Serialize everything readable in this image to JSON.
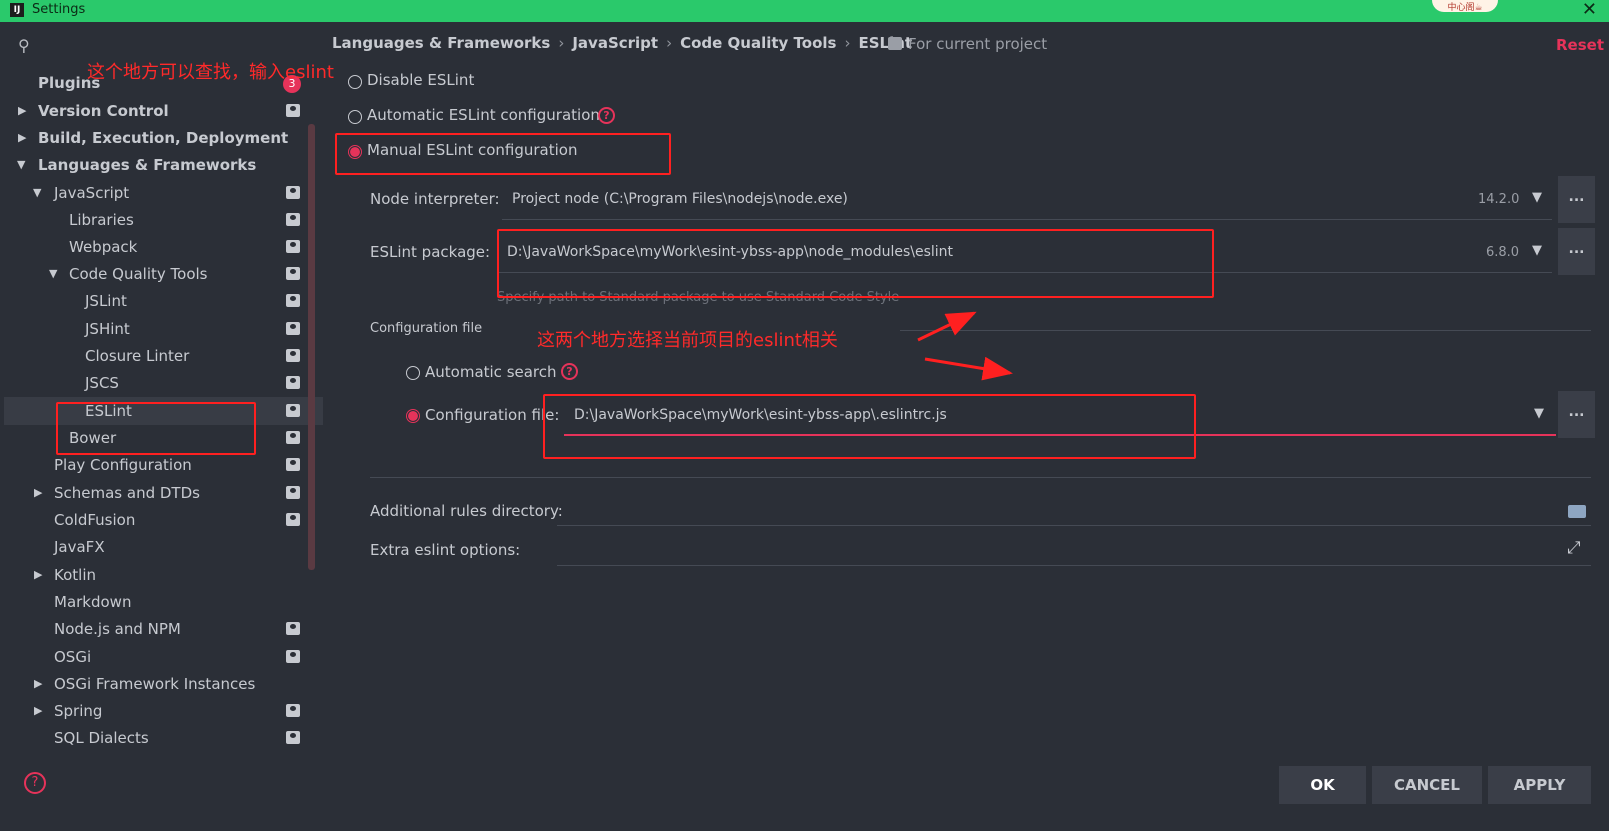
{
  "window": {
    "title": "Settings",
    "close_label": "✕",
    "badge_text": "中心阁☕"
  },
  "sidebar": {
    "items": [
      {
        "label": "Plugins",
        "bold": true
      },
      {
        "label": "Version Control",
        "bold": true
      },
      {
        "label": "Build, Execution, Deployment",
        "bold": true
      },
      {
        "label": "Languages & Frameworks",
        "bold": true
      },
      {
        "label": "JavaScript"
      },
      {
        "label": "Libraries"
      },
      {
        "label": "Webpack"
      },
      {
        "label": "Code Quality Tools"
      },
      {
        "label": "JSLint"
      },
      {
        "label": "JSHint"
      },
      {
        "label": "Closure Linter"
      },
      {
        "label": "JSCS"
      },
      {
        "label": "ESLint",
        "selected": true
      },
      {
        "label": "Bower"
      },
      {
        "label": "Play Configuration"
      },
      {
        "label": "Schemas and DTDs"
      },
      {
        "label": "ColdFusion"
      },
      {
        "label": "JavaFX"
      },
      {
        "label": "Kotlin"
      },
      {
        "label": "Markdown"
      },
      {
        "label": "Node.js and NPM"
      },
      {
        "label": "OSGi"
      },
      {
        "label": "OSGi Framework Instances"
      },
      {
        "label": "Spring"
      },
      {
        "label": "SQL Dialects"
      }
    ],
    "plugins_badge": "3",
    "help_label": "?"
  },
  "breadcrumb": [
    "Languages & Frameworks",
    "JavaScript",
    "Code Quality Tools",
    "ESLint"
  ],
  "breadcrumb_sep": "›",
  "scope_label": "For current project",
  "reset_label": "Reset",
  "eslint": {
    "disable_label": "Disable ESLint",
    "automatic_label": "Automatic ESLint configuration",
    "manual_label": "Manual ESLint configuration",
    "node_interpreter_label": "Node interpreter:",
    "node_interpreter_value": "Project  node (C:\\Program Files\\nodejs\\node.exe)",
    "node_version": "14.2.0",
    "package_label": "ESLint package:",
    "package_value": "D:\\JavaWorkSpace\\myWork\\esint-ybss-app\\node_modules\\eslint",
    "package_version": "6.8.0",
    "package_hint": "Specify path to Standard package to use Standard Code Style",
    "config_section_label": "Configuration file",
    "auto_search_label": "Automatic search",
    "config_file_label": "Configuration file:",
    "config_file_value": "D:\\JavaWorkSpace\\myWork\\esint-ybss-app\\.eslintrc.js",
    "rules_dir_label": "Additional rules directory:",
    "extra_options_label": "Extra eslint options:",
    "dots_label": "...",
    "dropdown_glyph": "▼"
  },
  "buttons": {
    "ok": "OK",
    "cancel": "CANCEL",
    "apply": "APPLY"
  },
  "annotations": {
    "search_note": "这个地方可以查找，输入eslint",
    "eslint_note": "这两个地方选择当前项目的eslint相关"
  },
  "colors": {
    "accent": "#e6335a",
    "annotation": "#ff2020",
    "titlebar": "#2ac96b",
    "background": "#2b2f37"
  }
}
